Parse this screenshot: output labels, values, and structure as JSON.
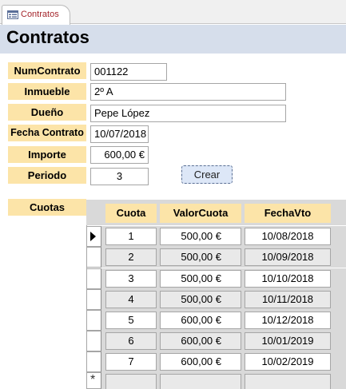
{
  "tab": {
    "label": "Contratos",
    "icon": "form-icon"
  },
  "form": {
    "title": "Contratos",
    "fields": {
      "num_contrato": {
        "label": "NumContrato",
        "value": "001122"
      },
      "inmueble": {
        "label": "Inmueble",
        "value": "2º A"
      },
      "dueno": {
        "label": "Dueño",
        "value": "Pepe López"
      },
      "fecha_contrato": {
        "label": "Fecha Contrato",
        "value": "10/07/2018"
      },
      "importe": {
        "label": "Importe",
        "value": "600,00 €"
      },
      "periodo": {
        "label": "Periodo",
        "value": "3"
      }
    },
    "crear_button": "Crear",
    "cuotas_label": "Cuotas"
  },
  "cuotas": {
    "columns": [
      "Cuota",
      "ValorCuota",
      "FechaVto"
    ],
    "rows": [
      [
        "1",
        "500,00 €",
        "10/08/2018"
      ],
      [
        "2",
        "500,00 €",
        "10/09/2018"
      ],
      [
        "3",
        "500,00 €",
        "10/10/2018"
      ],
      [
        "4",
        "500,00 €",
        "10/11/2018"
      ],
      [
        "5",
        "600,00 €",
        "10/12/2018"
      ],
      [
        "6",
        "600,00 €",
        "10/01/2019"
      ],
      [
        "7",
        "600,00 €",
        "10/02/2019"
      ]
    ],
    "new_record_marker": "*"
  },
  "colors": {
    "label_bg": "#fce4a8",
    "header_bg": "#d6deeb",
    "tab_text": "#a4262c",
    "button_bg": "#dde7f7"
  }
}
